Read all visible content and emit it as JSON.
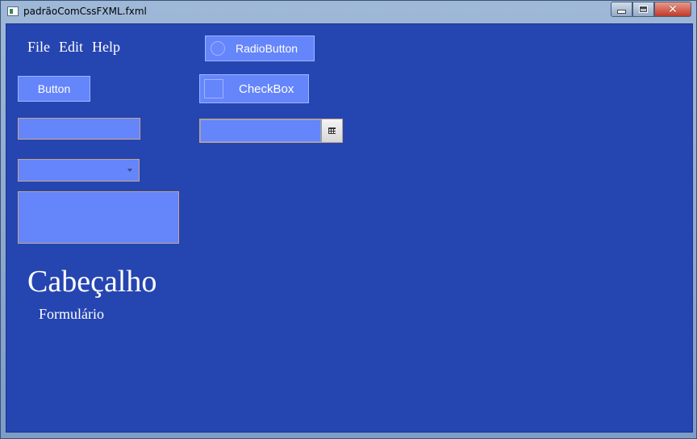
{
  "window": {
    "title": "padrãoComCssFXML.fxml"
  },
  "menu": {
    "items": [
      "File",
      "Edit",
      "Help"
    ]
  },
  "controls": {
    "button_label": "Button",
    "radio_label": "RadioButton",
    "radio_selected": false,
    "checkbox_label": "CheckBox",
    "checkbox_checked": false,
    "text_field_value": "",
    "combo_value": "",
    "date_value": "",
    "text_area_value": ""
  },
  "labels": {
    "heading": "Cabeçalho",
    "subheading": "Formulário"
  },
  "colors": {
    "background": "#2545b1",
    "control_fill": "#6585fb",
    "input_border": "#c7a58a",
    "close_button": "#c2392a"
  },
  "icons": [
    "app-icon",
    "minimize-icon",
    "maximize-icon",
    "close-icon",
    "radio-icon",
    "checkbox-icon",
    "calendar-icon",
    "chevron-down-icon"
  ]
}
